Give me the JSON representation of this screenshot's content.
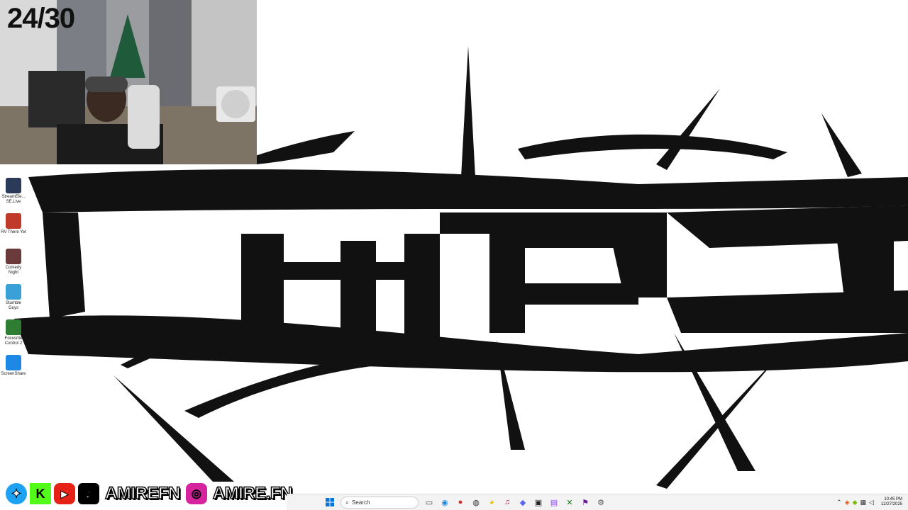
{
  "overlay": {
    "counter": "24/30"
  },
  "desktop_icons": [
    {
      "label": "StreamEle...\nSE.Live",
      "icon": "streamelements-icon",
      "color": "#2c3a5a"
    },
    {
      "label": "RV There Yet",
      "icon": "game-rv-icon",
      "color": "#c0392b"
    },
    {
      "label": "Comedy\nNight",
      "icon": "microphone-icon",
      "color": "#6b3a3a"
    },
    {
      "label": "Stumble\nGuys",
      "icon": "stumble-guys-icon",
      "color": "#3aa0d8"
    },
    {
      "label": "Focusrite\nControl 2",
      "icon": "focusrite-icon",
      "color": "#2e7d32"
    },
    {
      "label": "ScreenShare",
      "icon": "monitor-icon",
      "color": "#1e88e5"
    }
  ],
  "socials": {
    "handle_1": "AMIREFN",
    "handle_2": "AMIRE.FN",
    "icons": [
      "twitter-icon",
      "kick-icon",
      "youtube-icon",
      "tiktok-icon",
      "instagram-icon"
    ]
  },
  "taskbar": {
    "search_placeholder": "Search",
    "time": "10:45 PM",
    "date": "12/27/2025"
  }
}
